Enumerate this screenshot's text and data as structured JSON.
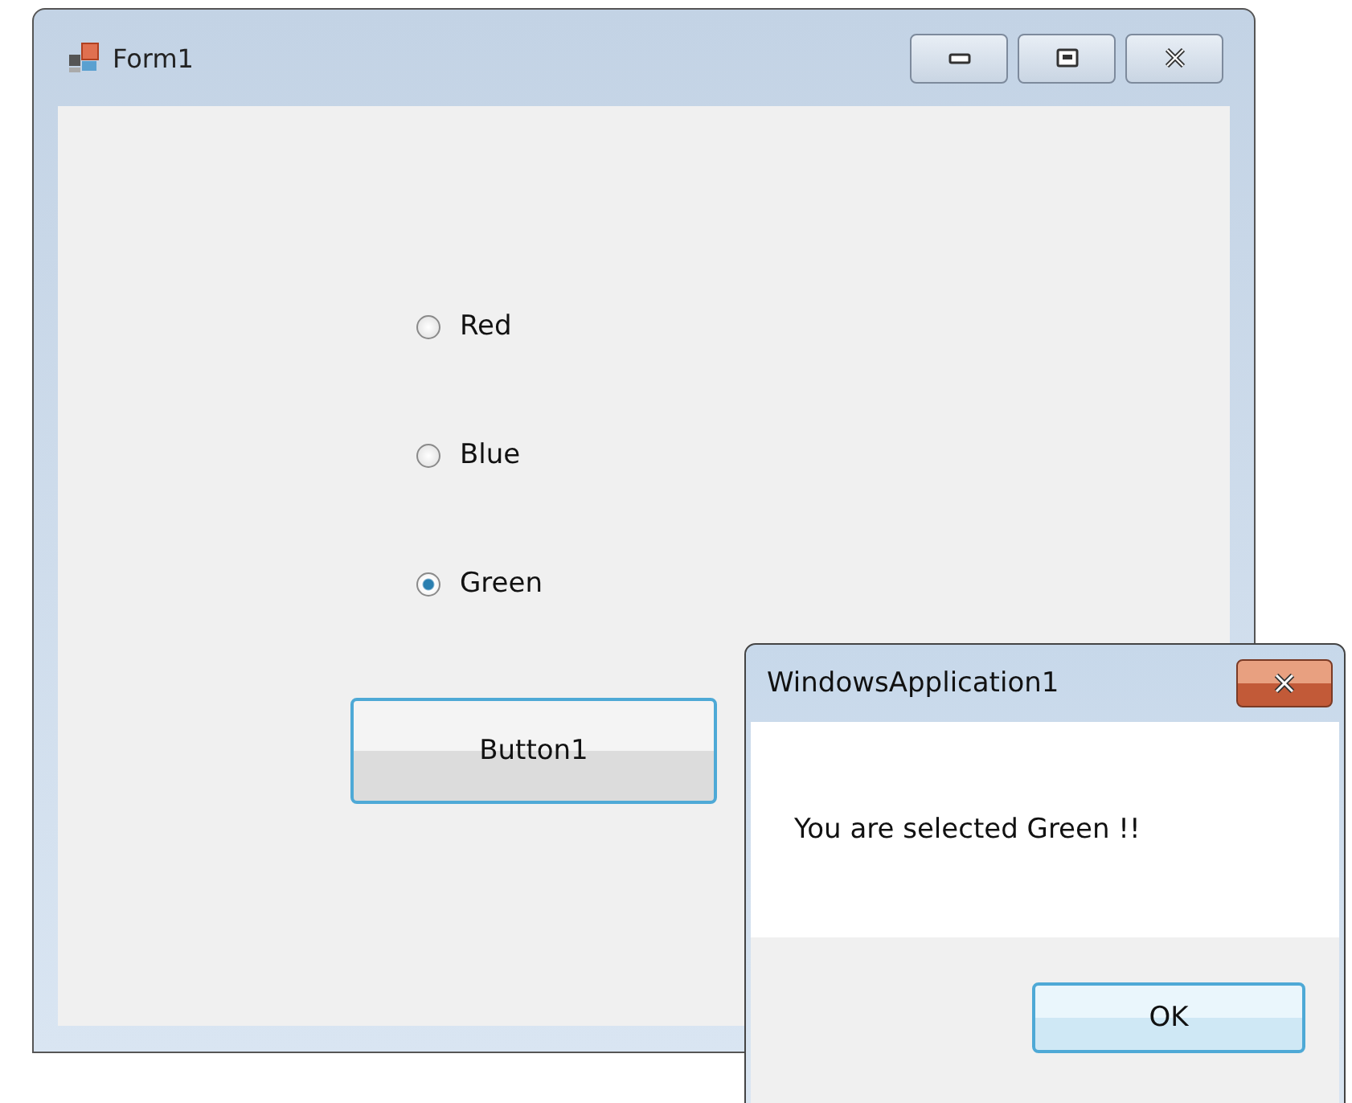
{
  "window": {
    "title": "Form1"
  },
  "radios": [
    {
      "label": "Red",
      "selected": false
    },
    {
      "label": "Blue",
      "selected": false
    },
    {
      "label": "Green",
      "selected": true
    }
  ],
  "button": "Button1",
  "dialog": {
    "title": "WindowsApplication1",
    "message": "You are selected Green !!",
    "button": "OK"
  }
}
